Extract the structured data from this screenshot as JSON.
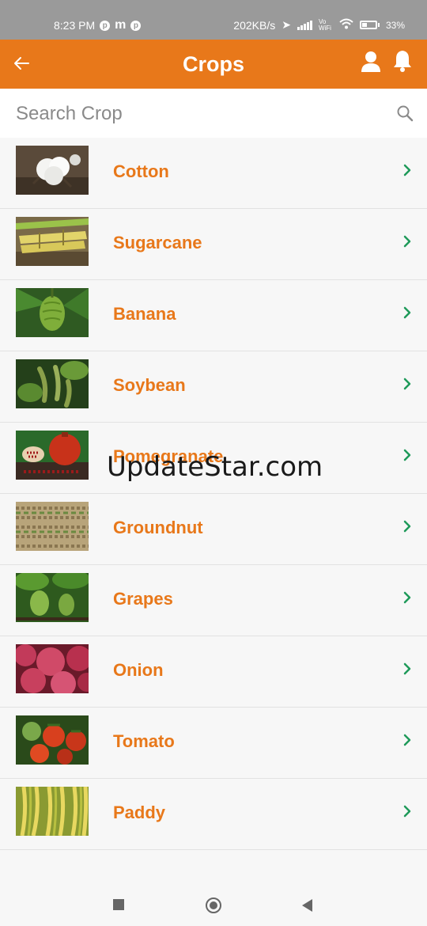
{
  "status_bar": {
    "time": "8:23 PM",
    "network_speed": "202KB/s",
    "vo_wifi": "Vo WiFi",
    "battery": "33%"
  },
  "header": {
    "title": "Crops",
    "back_icon": "arrow-left-icon",
    "user_icon": "user-icon",
    "bell_icon": "bell-icon",
    "background": "#e8781a"
  },
  "search": {
    "placeholder": "Search Crop",
    "value": ""
  },
  "crops": [
    {
      "name": "Cotton",
      "image": "cotton-image"
    },
    {
      "name": "Sugarcane",
      "image": "sugarcane-image"
    },
    {
      "name": "Banana",
      "image": "banana-image"
    },
    {
      "name": "Soybean",
      "image": "soybean-image"
    },
    {
      "name": "Pomegranate",
      "image": "pomegranate-image"
    },
    {
      "name": "Groundnut",
      "image": "groundnut-image"
    },
    {
      "name": "Grapes",
      "image": "grapes-image"
    },
    {
      "name": "Onion",
      "image": "onion-image"
    },
    {
      "name": "Tomato",
      "image": "tomato-image"
    },
    {
      "name": "Paddy",
      "image": "paddy-image"
    }
  ],
  "watermark": "UpdateStar.com",
  "colors": {
    "accent": "#e8781a",
    "chevron": "#1f9a5a",
    "status_bar": "#9a9a9a"
  }
}
